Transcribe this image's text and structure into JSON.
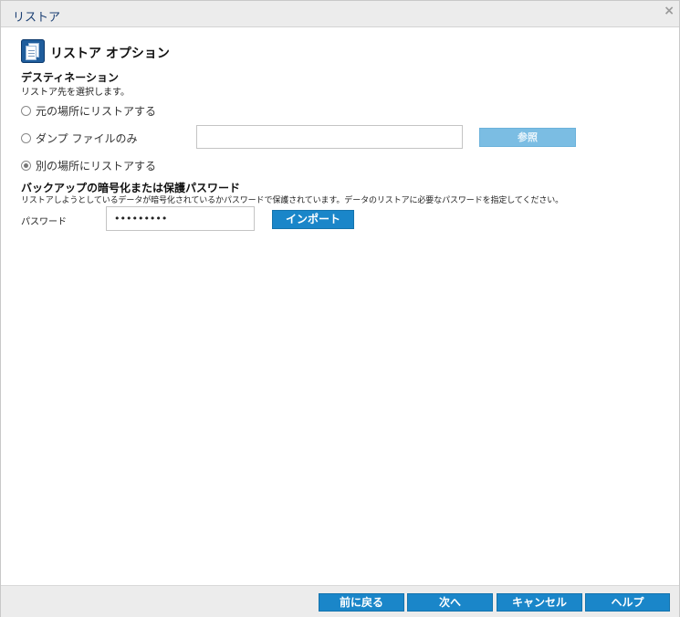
{
  "window": {
    "title": "リストア"
  },
  "section": {
    "title": "リストア オプション"
  },
  "destination": {
    "heading": "デスティネーション",
    "description": "リストア先を選択します。",
    "options": [
      {
        "label": "元の場所にリストアする",
        "selected": false
      },
      {
        "label": "ダンプ ファイルのみ",
        "selected": false
      },
      {
        "label": "別の場所にリストアする",
        "selected": true
      }
    ],
    "path_value": "",
    "browse_label": "参照"
  },
  "encryption": {
    "heading": "バックアップの暗号化または保護パスワード",
    "description": "リストアしようとしているデータが暗号化されているかパスワードで保護されています。データのリストアに必要なパスワードを指定してください。",
    "password_label": "パスワード",
    "password_value": "•••••••••",
    "import_label": "インポート"
  },
  "footer": {
    "back_label": "前に戻る",
    "next_label": "次へ",
    "cancel_label": "キャンセル",
    "help_label": "ヘルプ"
  },
  "colors": {
    "accent": "#1a86c9",
    "title_text": "#1b3f73",
    "disabled_button": "#7bbde3"
  },
  "icons": {
    "section": "document-stack-icon",
    "close": "close-icon"
  }
}
